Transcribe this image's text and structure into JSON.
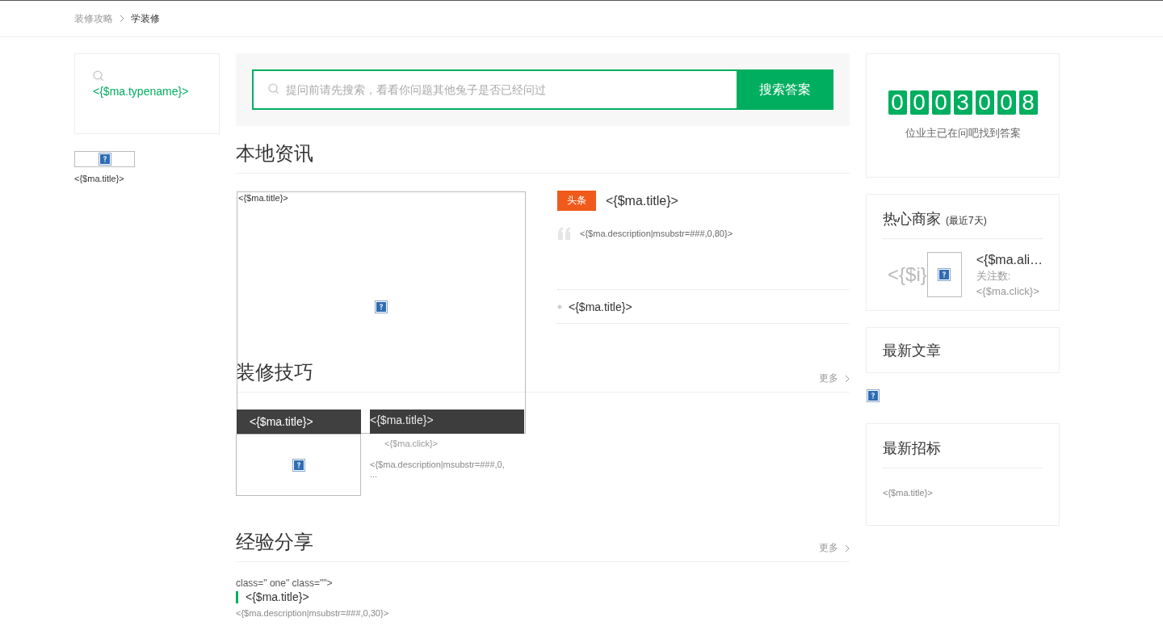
{
  "breadcrumb": [
    {
      "label": "装修攻略",
      "current": false
    },
    {
      "label": "学装修",
      "current": true
    }
  ],
  "category_card": {
    "typename": "<{$ma.typename}>"
  },
  "left_item": {
    "title": "<{$ma.title}>"
  },
  "search": {
    "placeholder": "提问前请先搜索，看看你问题其他兔子是否已经问过",
    "button": "搜索答案"
  },
  "local_news": {
    "heading": "本地资讯",
    "feature": {
      "title": "<{$ma.title}>",
      "caption": "<{$ma.title}>"
    },
    "headline": {
      "tag": "头条",
      "title": "<{$ma.title}>",
      "description": "<{$ma.description|msubstr=###,0,80}>"
    },
    "items": [
      {
        "title": "<{$ma.title}>"
      }
    ]
  },
  "tips": {
    "heading": "装修技巧",
    "more": "更多",
    "items": [
      {
        "title": "<{$ma.title}>",
        "click": "<{$ma.click}>",
        "description": "<{$ma.description|msubstr=###,0,",
        "ellipsis": "..."
      }
    ]
  },
  "share": {
    "heading": "经验分享",
    "more": "更多",
    "stray": "class=\" one\" class=\"\">",
    "items": [
      {
        "title": "<{$ma.title}>",
        "description": "<{$ma.description|msubstr=###,0,30}>"
      }
    ]
  },
  "counter": {
    "digits": [
      "0",
      "0",
      "0",
      "3",
      "0",
      "0",
      "8"
    ],
    "caption": "位业主已在问吧找到答案"
  },
  "merchants": {
    "heading": "热心商家",
    "note": "(最近7天)",
    "items": [
      {
        "index": "<{$i}",
        "name": "<{$ma.ali…",
        "follow_label": "关注数:",
        "follow_count": "<{$ma.click}>"
      }
    ]
  },
  "latest_articles": {
    "heading": "最新文章"
  },
  "tenders": {
    "heading": "最新招标",
    "items": [
      {
        "title": "<{$ma.title}>"
      }
    ]
  }
}
